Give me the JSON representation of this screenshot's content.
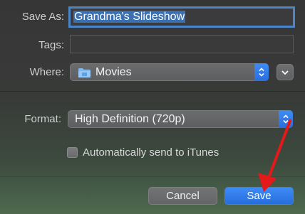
{
  "save_as": {
    "label": "Save As:",
    "value": "Grandma's Slideshow"
  },
  "tags": {
    "label": "Tags:",
    "value": ""
  },
  "where": {
    "label": "Where:",
    "value": "Movies",
    "icon": "folder-icon"
  },
  "format": {
    "label": "Format:",
    "value": "High Definition (720p)"
  },
  "itunes": {
    "label": "Automatically send to iTunes",
    "checked": false
  },
  "buttons": {
    "cancel": "Cancel",
    "save": "Save"
  },
  "colors": {
    "accent": "#2f7ae5",
    "arrow": "#e3191a"
  }
}
